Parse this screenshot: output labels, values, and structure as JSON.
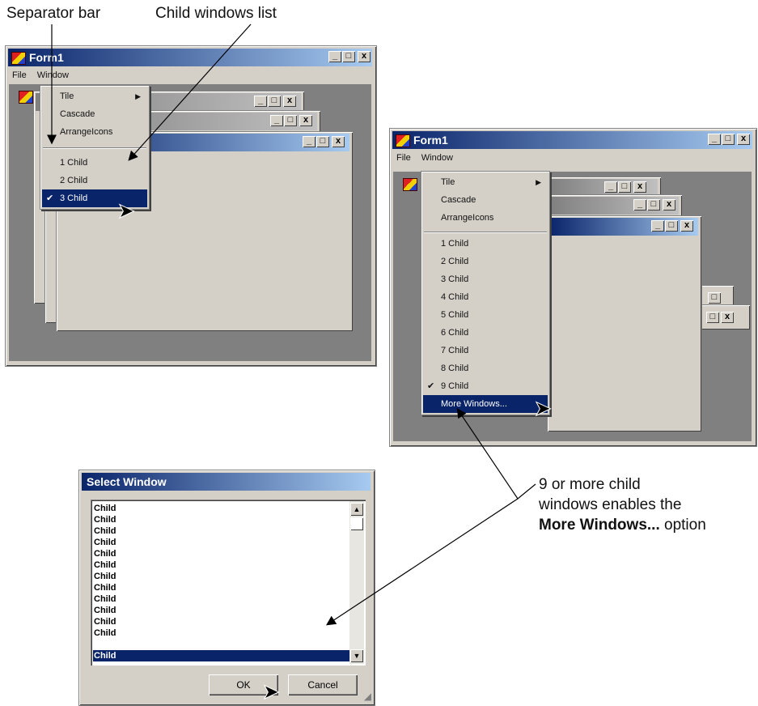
{
  "callouts": {
    "separator_bar": "Separator bar",
    "child_windows_list": "Child windows list",
    "note_line1": "9 or more child",
    "note_line2": "windows enables the",
    "note_bold": "More Windows...",
    "note_tail": " option"
  },
  "window_small": {
    "title": "Form1",
    "menu_file": "File",
    "menu_window": "Window",
    "menu_items": [
      "Tile",
      "Cascade",
      "ArrangeIcons"
    ],
    "child_items": [
      "1 Child",
      "2 Child",
      "3 Child"
    ],
    "checked_item": "3 Child"
  },
  "window_large": {
    "title": "Form1",
    "menu_file": "File",
    "menu_window": "Window",
    "menu_items": [
      "Tile",
      "Cascade",
      "ArrangeIcons"
    ],
    "child_items": [
      "1 Child",
      "2 Child",
      "3 Child",
      "4 Child",
      "5 Child",
      "6 Child",
      "7 Child",
      "8 Child",
      "9 Child"
    ],
    "more_windows": "More Windows..."
  },
  "dialog": {
    "title": "Select Window",
    "list_items": [
      "Child",
      "Child",
      "Child",
      "Child",
      "Child",
      "Child",
      "Child",
      "Child",
      "Child",
      "Child",
      "Child",
      "Child",
      "Child"
    ],
    "ok_label": "OK",
    "cancel_label": "Cancel"
  }
}
